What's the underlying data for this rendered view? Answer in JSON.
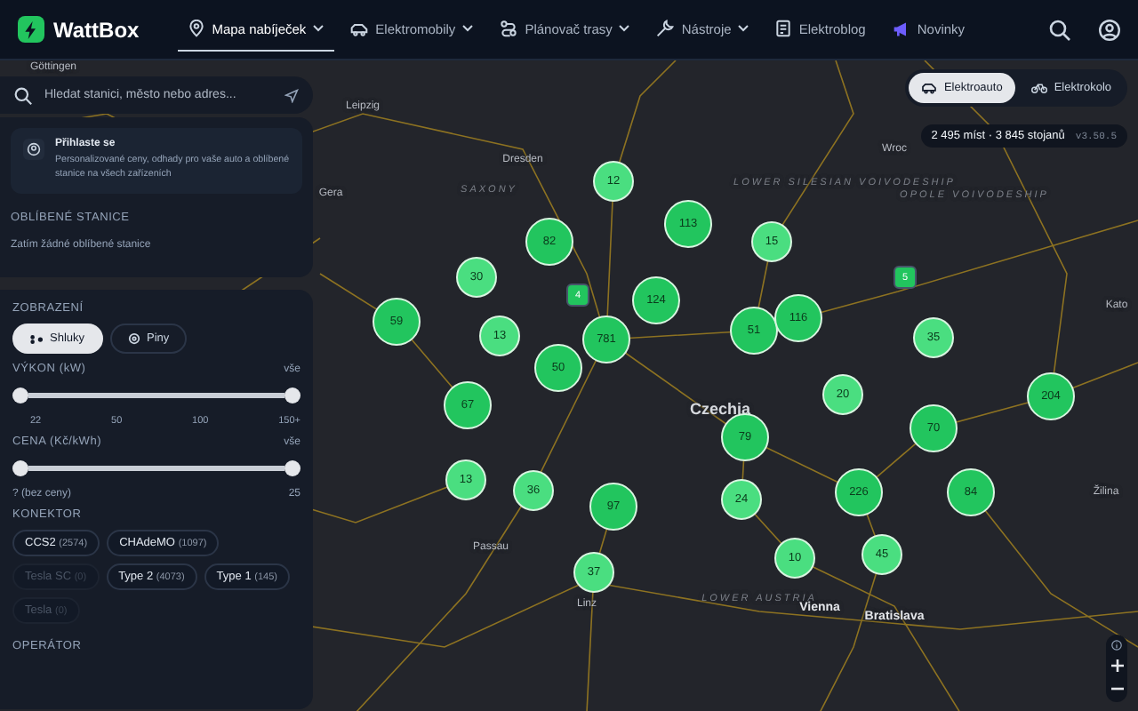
{
  "header": {
    "logo": "WattBox",
    "nav": [
      {
        "label": "Mapa nabíječek",
        "dropdown": true,
        "selected": true
      },
      {
        "label": "Elektromobily",
        "dropdown": true,
        "selected": false
      },
      {
        "label": "Plánovač trasy",
        "dropdown": true,
        "selected": false
      },
      {
        "label": "Nástroje",
        "dropdown": true,
        "selected": false
      },
      {
        "label": "Elektroblog",
        "dropdown": false,
        "selected": false
      },
      {
        "label": "Novinky",
        "dropdown": false,
        "selected": false
      }
    ]
  },
  "search": {
    "placeholder": "Hledat stanici, město nebo adres..."
  },
  "login": {
    "title": "Přihlaste se",
    "text": "Personalizované ceny, odhady pro vaše auto a oblíbené stanice na všech zařízeních"
  },
  "favorites": {
    "heading": "OBLÍBENÉ STANICE",
    "empty": "Zatím žádné oblíbené stanice"
  },
  "display": {
    "heading": "ZOBRAZENÍ",
    "options": [
      {
        "label": "Shluky",
        "selected": true
      },
      {
        "label": "Piny",
        "selected": false
      }
    ]
  },
  "power": {
    "heading": "VÝKON (kW)",
    "value": "vše",
    "thumbs": [
      {
        "level": 0
      },
      {
        "level": 1
      }
    ],
    "ticks": [
      "22",
      "50",
      "100",
      "150+"
    ]
  },
  "price": {
    "heading": "CENA (Kč/kWh)",
    "value": "vše",
    "thumbs": [
      {
        "level": 0
      },
      {
        "level": 1
      }
    ],
    "min_label": "? (bez ceny)",
    "max_label": "25"
  },
  "connectors": {
    "heading": "KONEKTOR",
    "items": [
      {
        "name": "CCS2",
        "count": "(2574)",
        "disabled": false
      },
      {
        "name": "CHAdeMO",
        "count": "(1097)",
        "disabled": false
      },
      {
        "name": "Tesla SC",
        "count": "(0)",
        "disabled": true
      },
      {
        "name": "Type 2",
        "count": "(4073)",
        "disabled": false
      },
      {
        "name": "Type 1",
        "count": "(145)",
        "disabled": false
      },
      {
        "name": "Tesla",
        "count": "(0)",
        "disabled": true
      }
    ]
  },
  "operator": {
    "heading": "OPERÁTOR"
  },
  "vehicle_toggle": [
    {
      "label": "Elektroauto",
      "selected": true
    },
    {
      "label": "Elektrokolo",
      "selected": false
    }
  ],
  "stats": {
    "text": "2 495 míst · 3 845 stojanů",
    "version": "v3.50.5"
  },
  "map_labels": [
    {
      "text": "Göttingen",
      "kind": "city"
    },
    {
      "text": "Leipzig",
      "kind": "city"
    },
    {
      "text": "Dresden",
      "kind": "city"
    },
    {
      "text": "SAXONY",
      "kind": "region"
    },
    {
      "text": "Gera",
      "kind": "city"
    },
    {
      "text": "Wroc",
      "kind": "city"
    },
    {
      "text": "LOWER SILESIAN VOIVODESHIP",
      "kind": "region"
    },
    {
      "text": "OPOLE VOIVODESHIP",
      "kind": "region"
    },
    {
      "text": "Kato",
      "kind": "city"
    },
    {
      "text": "Czechia",
      "kind": "country"
    },
    {
      "text": "Žilina",
      "kind": "city"
    },
    {
      "text": "Passau",
      "kind": "city"
    },
    {
      "text": "Linz",
      "kind": "city"
    },
    {
      "text": "LOWER AUSTRIA",
      "kind": "region"
    },
    {
      "text": "Vienna",
      "kind": "capital"
    },
    {
      "text": "Bratislava",
      "kind": "capital"
    }
  ],
  "clusters": [
    {
      "count": "12",
      "kind": "small"
    },
    {
      "count": "113",
      "kind": "large"
    },
    {
      "count": "82",
      "kind": "large"
    },
    {
      "count": "15",
      "kind": "small"
    },
    {
      "count": "30",
      "kind": "small"
    },
    {
      "count": "4",
      "kind": "single"
    },
    {
      "count": "124",
      "kind": "large"
    },
    {
      "count": "59",
      "kind": "large"
    },
    {
      "count": "13",
      "kind": "small"
    },
    {
      "count": "781",
      "kind": "large"
    },
    {
      "count": "51",
      "kind": "large"
    },
    {
      "count": "116",
      "kind": "large"
    },
    {
      "count": "5",
      "kind": "single"
    },
    {
      "count": "35",
      "kind": "small"
    },
    {
      "count": "50",
      "kind": "large"
    },
    {
      "count": "20",
      "kind": "small"
    },
    {
      "count": "204",
      "kind": "large"
    },
    {
      "count": "67",
      "kind": "large"
    },
    {
      "count": "79",
      "kind": "large"
    },
    {
      "count": "70",
      "kind": "large"
    },
    {
      "count": "13",
      "kind": "small"
    },
    {
      "count": "36",
      "kind": "small"
    },
    {
      "count": "97",
      "kind": "large"
    },
    {
      "count": "24",
      "kind": "small"
    },
    {
      "count": "226",
      "kind": "large"
    },
    {
      "count": "84",
      "kind": "large"
    },
    {
      "count": "10",
      "kind": "small"
    },
    {
      "count": "45",
      "kind": "small"
    },
    {
      "count": "37",
      "kind": "small"
    }
  ]
}
